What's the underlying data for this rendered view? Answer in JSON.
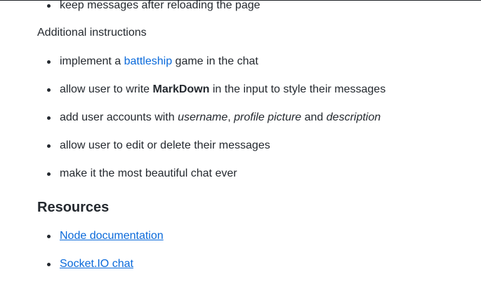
{
  "top_list": {
    "item_1": "keep messages after reloading the page"
  },
  "additional": {
    "heading": "Additional instructions",
    "item_1": {
      "before": "implement a ",
      "link": "battleship",
      "after": " game in the chat"
    },
    "item_2": {
      "before": "allow user to write ",
      "strong": "MarkDown",
      "after": " in the input to style their messages"
    },
    "item_3": {
      "before": "add user accounts with ",
      "em_1": "username",
      "sep_1": ", ",
      "em_2": "profile picture",
      "sep_2": " and ",
      "em_3": "description"
    },
    "item_4": "allow user to edit or delete their messages",
    "item_5": "make it the most beautiful chat ever"
  },
  "resources": {
    "heading": "Resources",
    "link_1": "Node documentation",
    "link_2": "Socket.IO chat"
  }
}
